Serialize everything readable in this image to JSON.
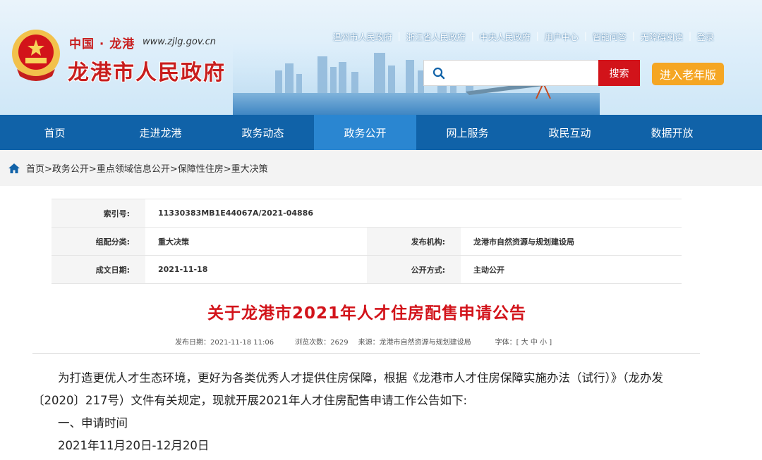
{
  "header": {
    "site_sub": "中国 · 龙港",
    "site_url": "www.zjlg.gov.cn",
    "site_name": "龙港市人民政府",
    "top_links": [
      "温州市人民政府",
      "浙江省人民政府",
      "中央人民政府",
      "用户中心",
      "智能问答",
      "无障碍阅读",
      "登录"
    ],
    "search_placeholder": "",
    "search_button": "搜索",
    "elder_button": "进入老年版"
  },
  "nav": {
    "items": [
      "首页",
      "走进龙港",
      "政务动态",
      "政务公开",
      "网上服务",
      "政民互动",
      "数据开放"
    ],
    "active_index": 3
  },
  "breadcrumb": [
    "首页>",
    "政务公开>",
    "重点领域信息公开>",
    "保障性住房>",
    "重大决策"
  ],
  "meta": {
    "index_label": "索引号:",
    "index_value": "11330383MB1E44067A/2021-04886",
    "category_label": "组配分类:",
    "category_value": "重大决策",
    "publisher_label": "发布机构:",
    "publisher_value": "龙港市自然资源与规划建设局",
    "date_label": "成文日期:",
    "date_value": "2021-11-18",
    "mode_label": "公开方式:",
    "mode_value": "主动公开"
  },
  "article": {
    "title": "关于龙港市2021年人才住房配售申请公告",
    "publish_time": "发布日期：2021-11-18 11:06",
    "views": "浏览次数：2629",
    "source": "来源：龙港市自然资源与规划建设局",
    "font_size": "字体：[ 大 中 小 ]",
    "para1": "为打造更优人才生态环境，更好为各类优秀人才提供住房保障，根据《龙港市人才住房保障实施办法（试行）》（龙办发〔2020〕217号）文件有关规定，现就开展2021年人才住房配售申请工作公告如下:",
    "section1": "一、申请时间",
    "section1_value": "2021年11月20日-12月20日"
  },
  "colors": {
    "brand_red": "#d2131a",
    "nav_blue": "#1062a8",
    "nav_active": "#2a86d1",
    "elder_orange": "#f5a623"
  }
}
